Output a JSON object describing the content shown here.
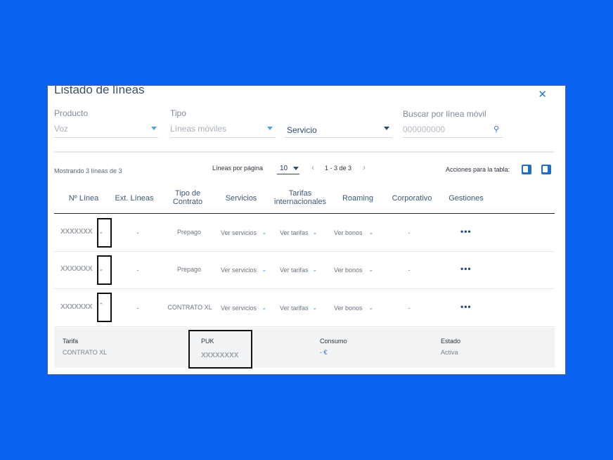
{
  "title": "Listado de líneas",
  "filters": {
    "producto": {
      "label": "Producto",
      "value": "Voz"
    },
    "tipo": {
      "label": "Tipo",
      "value": "Líneas móviles"
    },
    "servicio": {
      "value": "Servicio"
    },
    "buscar": {
      "label": "Buscar por línea móvil",
      "placeholder": "000000000"
    }
  },
  "summary": "Mostrando 3 líneas de 3",
  "pager": {
    "label": "Líneas por página",
    "per_page": "10",
    "range": "1 - 3 de 3"
  },
  "actions_label": "Acciones para la tabla:",
  "columns": [
    "Nº Línea",
    "Ext. Líneas",
    "Tipo de Contrato",
    "Servicios",
    "Tarifas internacionales",
    "Roaming",
    "Corporativo",
    "Gestiones"
  ],
  "rows": [
    {
      "linea": "XXXXXXX",
      "ext": "-",
      "tipo": "Prepago",
      "servicios": "Ver servicios",
      "tarifas": "Ver tarifas",
      "roaming": "Ver bonos",
      "corporativo": "-",
      "expanded": false
    },
    {
      "linea": "XXXXXXX",
      "ext": "-",
      "tipo": "Prepago",
      "servicios": "Ver servicios",
      "tarifas": "Ver tarifas",
      "roaming": "Ver bonos",
      "corporativo": "-",
      "expanded": false
    },
    {
      "linea": "XXXXXXX",
      "ext": "-",
      "tipo": "CONTRATO XL",
      "servicios": "Ver servicios",
      "tarifas": "Ver tarifas",
      "roaming": "Ver bonos",
      "corporativo": "-",
      "expanded": true
    }
  ],
  "detail": {
    "tarifa": {
      "label": "Tarifa",
      "value": "CONTRATO XL"
    },
    "puk": {
      "label": "PUK",
      "value": "XXXXXXXX"
    },
    "consumo": {
      "label": "Consumo",
      "value": "- €"
    },
    "estado": {
      "label": "Estado",
      "value": "Activa"
    }
  },
  "colors": {
    "background": "#0a63f0",
    "accent": "#2a78c9",
    "excel_dark": "#1f6fc6",
    "excel_light": "#1f6fc6"
  },
  "icons": {
    "close": "close-icon",
    "search": "search-icon",
    "caret": "chevron-down-icon",
    "more": "more-options-icon"
  }
}
